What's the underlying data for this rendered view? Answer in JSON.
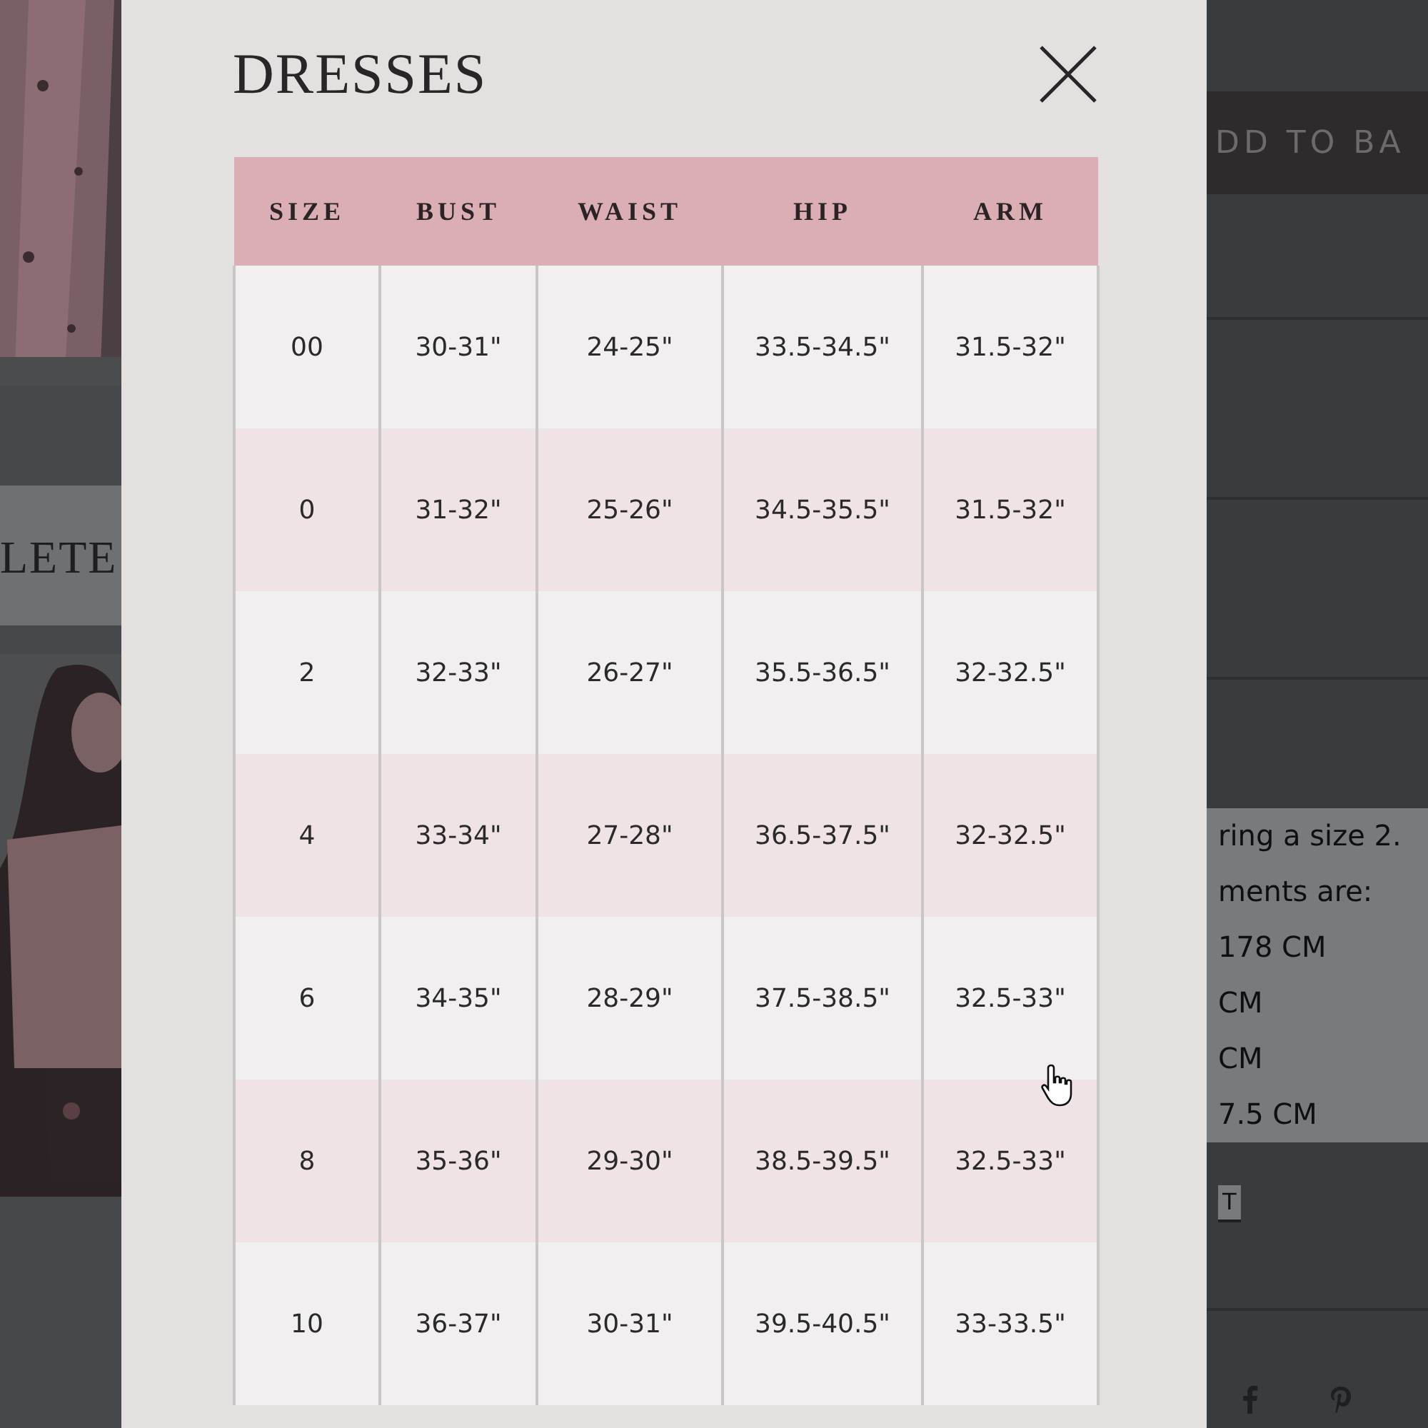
{
  "background": {
    "left_heading": "LETE",
    "add_button": "DD TO BA",
    "info_lines": [
      "ring a size 2.",
      "ments are:",
      "178 CM",
      "CM",
      "CM",
      "7.5 CM"
    ],
    "link": "T"
  },
  "modal": {
    "title": "DRESSES",
    "table": {
      "columns": [
        "SIZE",
        "BUST",
        "WAIST",
        "HIP",
        "ARM"
      ],
      "rows": [
        [
          "00",
          "30-31\"",
          "24-25\"",
          "33.5-34.5\"",
          "31.5-32\""
        ],
        [
          "0",
          "31-32\"",
          "25-26\"",
          "34.5-35.5\"",
          "31.5-32\""
        ],
        [
          "2",
          "32-33\"",
          "26-27\"",
          "35.5-36.5\"",
          "32-32.5\""
        ],
        [
          "4",
          "33-34\"",
          "27-28\"",
          "36.5-37.5\"",
          "32-32.5\""
        ],
        [
          "6",
          "34-35\"",
          "28-29\"",
          "37.5-38.5\"",
          "32.5-33\""
        ],
        [
          "8",
          "35-36\"",
          "29-30\"",
          "38.5-39.5\"",
          "32.5-33\""
        ],
        [
          "10",
          "36-37\"",
          "30-31\"",
          "39.5-40.5\"",
          "33-33.5\""
        ]
      ]
    }
  }
}
